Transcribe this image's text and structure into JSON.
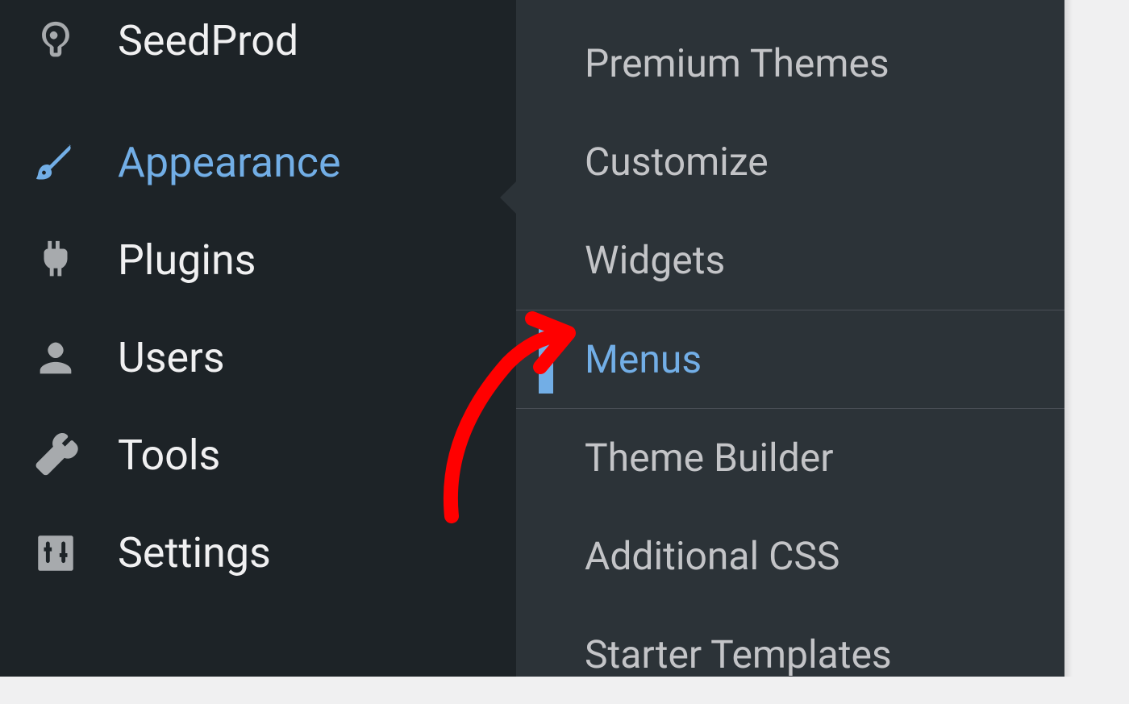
{
  "sidebar": {
    "items": [
      {
        "label": "SeedProd",
        "icon": "seedprod-icon",
        "active": false
      },
      {
        "label": "Appearance",
        "icon": "brush-icon",
        "active": true
      },
      {
        "label": "Plugins",
        "icon": "plug-icon",
        "active": false
      },
      {
        "label": "Users",
        "icon": "user-icon",
        "active": false
      },
      {
        "label": "Tools",
        "icon": "wrench-icon",
        "active": false
      },
      {
        "label": "Settings",
        "icon": "sliders-icon",
        "active": false
      }
    ]
  },
  "submenu": {
    "items": [
      {
        "label": "Premium Themes",
        "selected": false
      },
      {
        "label": "Customize",
        "selected": false
      },
      {
        "label": "Widgets",
        "selected": false
      },
      {
        "label": "Menus",
        "selected": true
      },
      {
        "label": "Theme Builder",
        "selected": false
      },
      {
        "label": "Additional CSS",
        "selected": false
      },
      {
        "label": "Starter Templates",
        "selected": false
      }
    ]
  },
  "colors": {
    "accent": "#72aee6",
    "sidebar_bg": "#1d2327",
    "submenu_bg": "#2c3338",
    "text_light": "#f0f0f1",
    "text_muted": "#c3c4c7",
    "annotation": "#ff0000"
  }
}
